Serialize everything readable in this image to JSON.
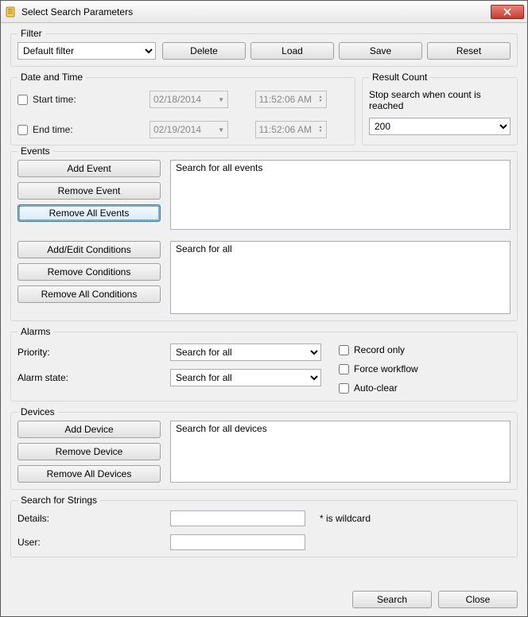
{
  "window": {
    "title": "Select Search Parameters"
  },
  "filter": {
    "legend": "Filter",
    "selected": "Default filter",
    "delete": "Delete",
    "load": "Load",
    "save": "Save",
    "reset": "Reset"
  },
  "datetime": {
    "legend": "Date and Time",
    "start_label": "Start time:",
    "end_label": "End time:",
    "start_date": "02/18/2014",
    "end_date": "02/19/2014",
    "start_time": "11:52:06 AM",
    "end_time": "11:52:06 AM"
  },
  "result_count": {
    "legend": "Result Count",
    "note": "Stop search when count is reached",
    "value": "200"
  },
  "events": {
    "legend": "Events",
    "add_event": "Add Event",
    "remove_event": "Remove Event",
    "remove_all_events": "Remove All Events",
    "add_conditions": "Add/Edit Conditions",
    "remove_conditions": "Remove Conditions",
    "remove_all_conditions": "Remove All Conditions",
    "events_list_text": "Search for all events",
    "conditions_list_text": "Search for all"
  },
  "alarms": {
    "legend": "Alarms",
    "priority_label": "Priority:",
    "state_label": "Alarm state:",
    "priority_value": "Search for all",
    "state_value": "Search for all",
    "record_only": "Record only",
    "force_workflow": "Force workflow",
    "auto_clear": "Auto-clear"
  },
  "devices": {
    "legend": "Devices",
    "add_device": "Add Device",
    "remove_device": "Remove Device",
    "remove_all_devices": "Remove All Devices",
    "list_text": "Search for all devices"
  },
  "strings": {
    "legend": "Search for Strings",
    "details_label": "Details:",
    "user_label": "User:",
    "wildcard_note": "* is wildcard"
  },
  "footer": {
    "search": "Search",
    "close": "Close"
  }
}
